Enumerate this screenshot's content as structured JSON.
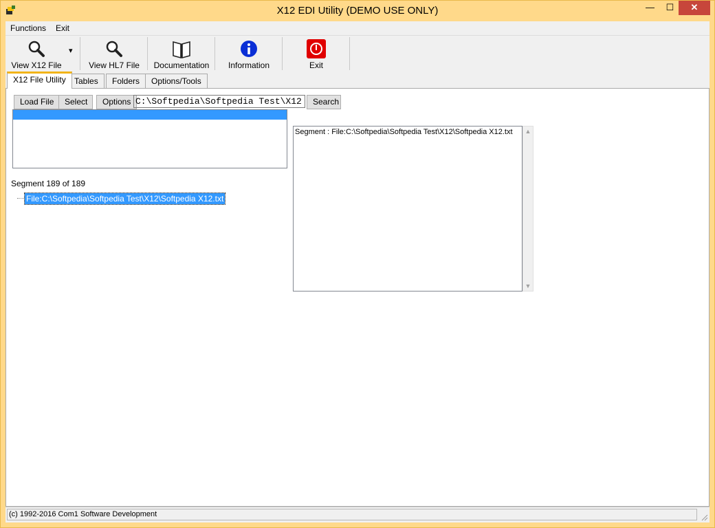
{
  "window": {
    "title": "X12 EDI Utility  (DEMO USE ONLY)",
    "min_glyph": "—",
    "max_glyph": "☐",
    "close_glyph": "✕"
  },
  "menu": {
    "items": [
      "Functions",
      "Exit"
    ]
  },
  "toolbar": {
    "buttons": [
      {
        "label": "View X12 File",
        "icon": "magnifier-icon"
      },
      {
        "label": "View HL7 File",
        "icon": "magnifier-icon"
      },
      {
        "label": "Documentation",
        "icon": "book-icon"
      },
      {
        "label": "Information",
        "icon": "info-icon"
      },
      {
        "label": "Exit",
        "icon": "power-icon"
      }
    ],
    "dropdown_glyph": "▾"
  },
  "tabs": [
    "X12 File Utility",
    "Tables",
    "Folders",
    "Options/Tools"
  ],
  "utility": {
    "load_button": "Load File",
    "select_button": "Select",
    "options_button": "Options",
    "path_value": "C:\\Softpedia\\Softpedia Test\\X12",
    "search_button": "Search",
    "segment_count": "Segment 189 of 189",
    "tree_node": "File:C:\\Softpedia\\Softpedia Test\\X12\\Softpedia X12.txt",
    "segment_text": "Segment : File:C:\\Softpedia\\Softpedia Test\\X12\\Softpedia X12.txt",
    "scroll_up_glyph": "▲",
    "scroll_down_glyph": "▼"
  },
  "status": {
    "text": "(c) 1992-2016 Com1 Software Development"
  },
  "colors": {
    "accent_tab": "#f2b418",
    "selection": "#3399ff",
    "close_button": "#c7463b",
    "info_blue": "#0a2fd6",
    "exit_red": "#e00000"
  }
}
